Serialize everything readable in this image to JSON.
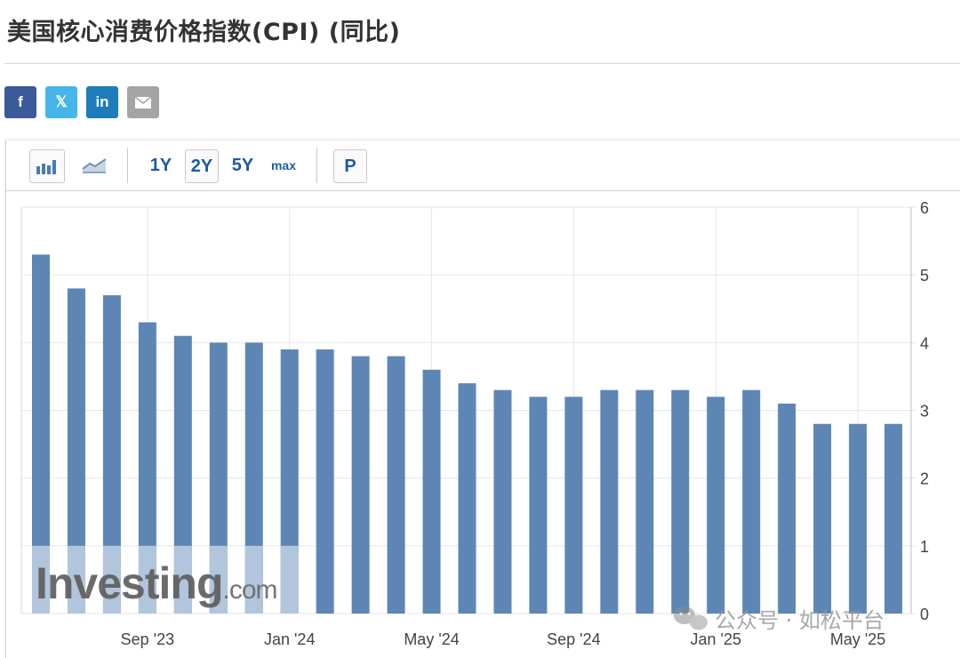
{
  "title": "美国核心消费价格指数(CPI) (同比)",
  "share": {
    "facebook": "f",
    "twitter": "𝕏",
    "linkedin": "in",
    "email_icon": "envelope-icon"
  },
  "toolbar": {
    "bar_chart_icon": "bar-chart-icon",
    "line_chart_icon": "line-chart-icon",
    "range_1y": "1Y",
    "range_2y": "2Y",
    "range_5y": "5Y",
    "range_max": "max",
    "selected_range": "2Y",
    "p_button": "P"
  },
  "watermark": {
    "brand": "Investing",
    "suffix": ".com"
  },
  "overlay_text": "公众号 · 如松平台",
  "colors": {
    "bar": "#5d86b4",
    "bar_watermark": "#b1c5dc",
    "grid": "#e6e6e6"
  },
  "chart_data": {
    "type": "bar",
    "x": [
      "2023-06",
      "2023-07",
      "2023-08",
      "2023-09",
      "2023-10",
      "2023-11",
      "2023-12",
      "2024-01",
      "2024-02",
      "2024-03",
      "2024-04",
      "2024-05",
      "2024-06",
      "2024-07",
      "2024-08",
      "2024-09",
      "2024-10",
      "2024-11",
      "2024-12",
      "2025-01",
      "2025-02",
      "2025-03",
      "2025-04",
      "2025-05",
      "2025-06"
    ],
    "values": [
      5.3,
      4.8,
      4.7,
      4.3,
      4.1,
      4.0,
      4.0,
      3.9,
      3.9,
      3.8,
      3.8,
      3.6,
      3.4,
      3.3,
      3.2,
      3.2,
      3.3,
      3.3,
      3.3,
      3.2,
      3.3,
      3.1,
      2.8,
      2.8,
      2.8
    ],
    "xtick_labels": [
      "Sep '23",
      "Jan '24",
      "May '24",
      "Sep '24",
      "Jan '25",
      "May '25"
    ],
    "xtick_positions": [
      "2023-09",
      "2024-01",
      "2024-05",
      "2024-09",
      "2025-01",
      "2025-05"
    ],
    "ytick_labels": [
      "0",
      "1",
      "2",
      "3",
      "4",
      "5",
      "6"
    ],
    "ylim": [
      0,
      6
    ],
    "yaxis_side": "right",
    "grid": true
  }
}
